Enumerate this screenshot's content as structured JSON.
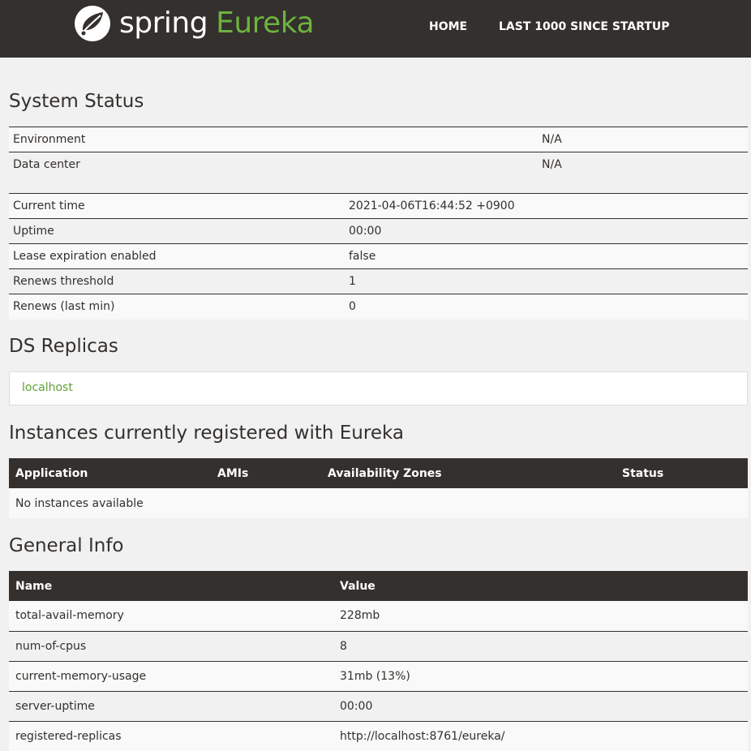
{
  "navbar": {
    "brand_spring": "spring",
    "brand_eureka": "Eureka",
    "links": [
      "HOME",
      "LAST 1000 SINCE STARTUP"
    ]
  },
  "system_status": {
    "title": "System Status",
    "env_rows": [
      {
        "label": "Environment",
        "value": "N/A"
      },
      {
        "label": "Data center",
        "value": "N/A"
      }
    ],
    "stat_rows": [
      {
        "label": "Current time",
        "value": "2021-04-06T16:44:52 +0900"
      },
      {
        "label": "Uptime",
        "value": "00:00"
      },
      {
        "label": "Lease expiration enabled",
        "value": "false"
      },
      {
        "label": "Renews threshold",
        "value": "1"
      },
      {
        "label": "Renews (last min)",
        "value": "0"
      }
    ]
  },
  "ds_replicas": {
    "title": "DS Replicas",
    "replica": "localhost"
  },
  "instances": {
    "title": "Instances currently registered with Eureka",
    "headers": [
      "Application",
      "AMIs",
      "Availability Zones",
      "Status"
    ],
    "empty_message": "No instances available"
  },
  "general_info": {
    "title": "General Info",
    "headers": [
      "Name",
      "Value"
    ],
    "rows": [
      {
        "name": "total-avail-memory",
        "value": "228mb"
      },
      {
        "name": "num-of-cpus",
        "value": "8"
      },
      {
        "name": "current-memory-usage",
        "value": "31mb (13%)"
      },
      {
        "name": "server-uptime",
        "value": "00:00"
      },
      {
        "name": "registered-replicas",
        "value": "http://localhost:8761/eureka/"
      }
    ]
  },
  "colors": {
    "navbar_bg": "#34302d",
    "accent_green": "#6db33f",
    "page_bg": "#f1f1f1"
  }
}
